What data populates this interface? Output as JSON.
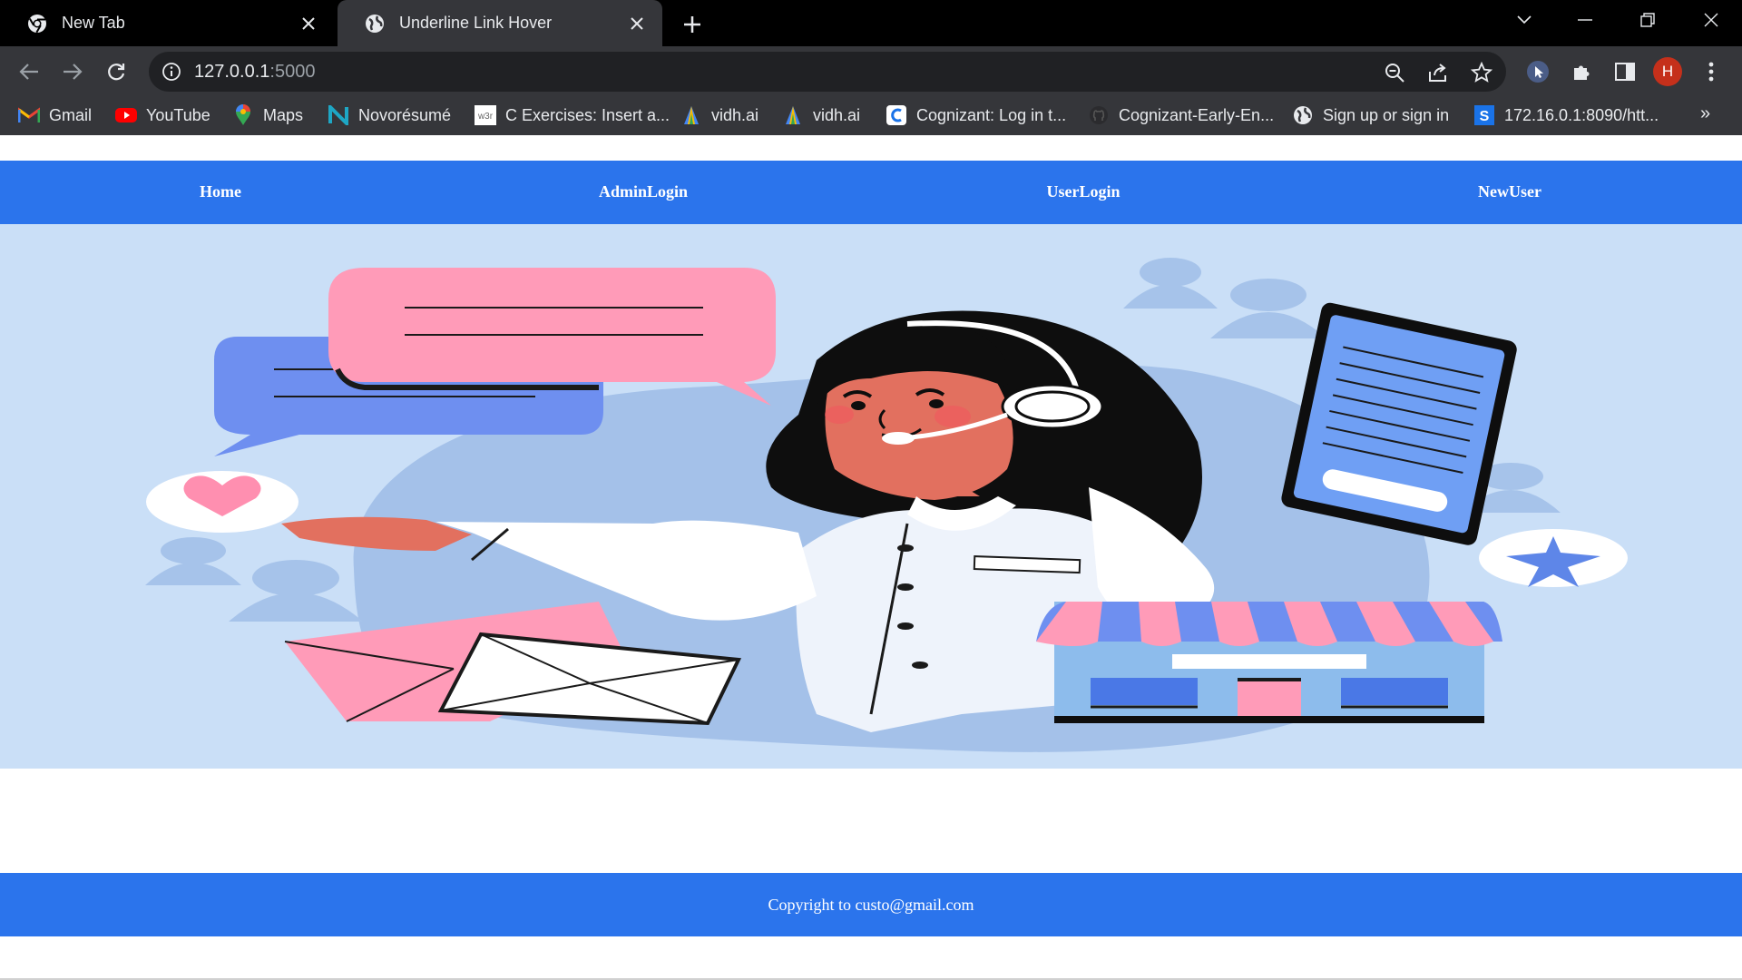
{
  "browser": {
    "tabs": [
      {
        "title": "New Tab",
        "icon": "chrome-icon",
        "active": false
      },
      {
        "title": "Underline Link Hover",
        "icon": "globe-icon",
        "active": true
      }
    ],
    "address": {
      "host": "127.0.0.1",
      "port": ":5000"
    },
    "profile_initial": "H",
    "bookmarks": [
      {
        "label": "Gmail",
        "icon": "gmail-icon"
      },
      {
        "label": "YouTube",
        "icon": "youtube-icon"
      },
      {
        "label": "Maps",
        "icon": "maps-icon"
      },
      {
        "label": "Novorésumé",
        "icon": "novoresume-icon"
      },
      {
        "label": "C Exercises: Insert a...",
        "icon": "w3r-icon"
      },
      {
        "label": "vidh.ai",
        "icon": "vidhai-icon"
      },
      {
        "label": "vidh.ai",
        "icon": "vidhai-icon"
      },
      {
        "label": "Cognizant: Log in t...",
        "icon": "cognizant-icon"
      },
      {
        "label": "Cognizant-Early-En...",
        "icon": "github-icon"
      },
      {
        "label": "Sign up or sign in",
        "icon": "globe-icon"
      },
      {
        "label": "172.16.0.1:8090/htt...",
        "icon": "sophos-icon"
      }
    ],
    "overflow_label": "»"
  },
  "page": {
    "nav": {
      "home": "Home",
      "admin_login": "AdminLogin",
      "user_login": "UserLogin",
      "new_user": "NewUser"
    },
    "hero_image": "customer-support-illustration",
    "footer_text": "Copyright to custo@gmail.com"
  },
  "colors": {
    "nav_bar": "#2b74ec",
    "hero_bg": "#cadff7",
    "chrome_dark": "#35363a",
    "tabstrip": "#000000",
    "accent_pink": "#ff9bb8",
    "accent_blue": "#6e8ff0"
  }
}
